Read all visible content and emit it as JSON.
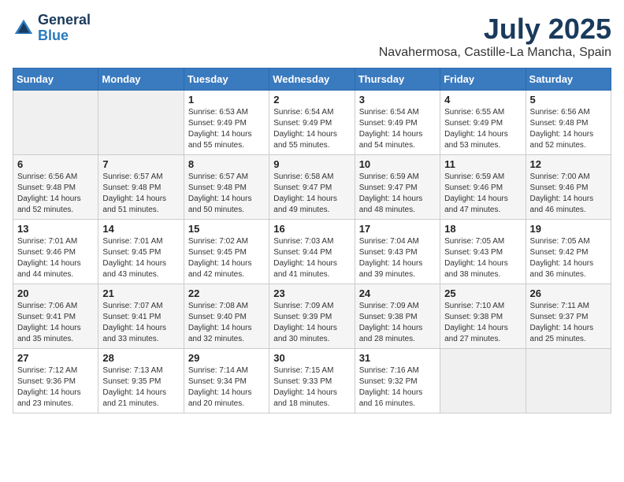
{
  "logo": {
    "line1": "General",
    "line2": "Blue"
  },
  "title": "July 2025",
  "subtitle": "Navahermosa, Castille-La Mancha, Spain",
  "weekdays": [
    "Sunday",
    "Monday",
    "Tuesday",
    "Wednesday",
    "Thursday",
    "Friday",
    "Saturday"
  ],
  "weeks": [
    [
      {
        "day": "",
        "info": ""
      },
      {
        "day": "",
        "info": ""
      },
      {
        "day": "1",
        "info": "Sunrise: 6:53 AM\nSunset: 9:49 PM\nDaylight: 14 hours and 55 minutes."
      },
      {
        "day": "2",
        "info": "Sunrise: 6:54 AM\nSunset: 9:49 PM\nDaylight: 14 hours and 55 minutes."
      },
      {
        "day": "3",
        "info": "Sunrise: 6:54 AM\nSunset: 9:49 PM\nDaylight: 14 hours and 54 minutes."
      },
      {
        "day": "4",
        "info": "Sunrise: 6:55 AM\nSunset: 9:49 PM\nDaylight: 14 hours and 53 minutes."
      },
      {
        "day": "5",
        "info": "Sunrise: 6:56 AM\nSunset: 9:48 PM\nDaylight: 14 hours and 52 minutes."
      }
    ],
    [
      {
        "day": "6",
        "info": "Sunrise: 6:56 AM\nSunset: 9:48 PM\nDaylight: 14 hours and 52 minutes."
      },
      {
        "day": "7",
        "info": "Sunrise: 6:57 AM\nSunset: 9:48 PM\nDaylight: 14 hours and 51 minutes."
      },
      {
        "day": "8",
        "info": "Sunrise: 6:57 AM\nSunset: 9:48 PM\nDaylight: 14 hours and 50 minutes."
      },
      {
        "day": "9",
        "info": "Sunrise: 6:58 AM\nSunset: 9:47 PM\nDaylight: 14 hours and 49 minutes."
      },
      {
        "day": "10",
        "info": "Sunrise: 6:59 AM\nSunset: 9:47 PM\nDaylight: 14 hours and 48 minutes."
      },
      {
        "day": "11",
        "info": "Sunrise: 6:59 AM\nSunset: 9:46 PM\nDaylight: 14 hours and 47 minutes."
      },
      {
        "day": "12",
        "info": "Sunrise: 7:00 AM\nSunset: 9:46 PM\nDaylight: 14 hours and 46 minutes."
      }
    ],
    [
      {
        "day": "13",
        "info": "Sunrise: 7:01 AM\nSunset: 9:46 PM\nDaylight: 14 hours and 44 minutes."
      },
      {
        "day": "14",
        "info": "Sunrise: 7:01 AM\nSunset: 9:45 PM\nDaylight: 14 hours and 43 minutes."
      },
      {
        "day": "15",
        "info": "Sunrise: 7:02 AM\nSunset: 9:45 PM\nDaylight: 14 hours and 42 minutes."
      },
      {
        "day": "16",
        "info": "Sunrise: 7:03 AM\nSunset: 9:44 PM\nDaylight: 14 hours and 41 minutes."
      },
      {
        "day": "17",
        "info": "Sunrise: 7:04 AM\nSunset: 9:43 PM\nDaylight: 14 hours and 39 minutes."
      },
      {
        "day": "18",
        "info": "Sunrise: 7:05 AM\nSunset: 9:43 PM\nDaylight: 14 hours and 38 minutes."
      },
      {
        "day": "19",
        "info": "Sunrise: 7:05 AM\nSunset: 9:42 PM\nDaylight: 14 hours and 36 minutes."
      }
    ],
    [
      {
        "day": "20",
        "info": "Sunrise: 7:06 AM\nSunset: 9:41 PM\nDaylight: 14 hours and 35 minutes."
      },
      {
        "day": "21",
        "info": "Sunrise: 7:07 AM\nSunset: 9:41 PM\nDaylight: 14 hours and 33 minutes."
      },
      {
        "day": "22",
        "info": "Sunrise: 7:08 AM\nSunset: 9:40 PM\nDaylight: 14 hours and 32 minutes."
      },
      {
        "day": "23",
        "info": "Sunrise: 7:09 AM\nSunset: 9:39 PM\nDaylight: 14 hours and 30 minutes."
      },
      {
        "day": "24",
        "info": "Sunrise: 7:09 AM\nSunset: 9:38 PM\nDaylight: 14 hours and 28 minutes."
      },
      {
        "day": "25",
        "info": "Sunrise: 7:10 AM\nSunset: 9:38 PM\nDaylight: 14 hours and 27 minutes."
      },
      {
        "day": "26",
        "info": "Sunrise: 7:11 AM\nSunset: 9:37 PM\nDaylight: 14 hours and 25 minutes."
      }
    ],
    [
      {
        "day": "27",
        "info": "Sunrise: 7:12 AM\nSunset: 9:36 PM\nDaylight: 14 hours and 23 minutes."
      },
      {
        "day": "28",
        "info": "Sunrise: 7:13 AM\nSunset: 9:35 PM\nDaylight: 14 hours and 21 minutes."
      },
      {
        "day": "29",
        "info": "Sunrise: 7:14 AM\nSunset: 9:34 PM\nDaylight: 14 hours and 20 minutes."
      },
      {
        "day": "30",
        "info": "Sunrise: 7:15 AM\nSunset: 9:33 PM\nDaylight: 14 hours and 18 minutes."
      },
      {
        "day": "31",
        "info": "Sunrise: 7:16 AM\nSunset: 9:32 PM\nDaylight: 14 hours and 16 minutes."
      },
      {
        "day": "",
        "info": ""
      },
      {
        "day": "",
        "info": ""
      }
    ]
  ]
}
